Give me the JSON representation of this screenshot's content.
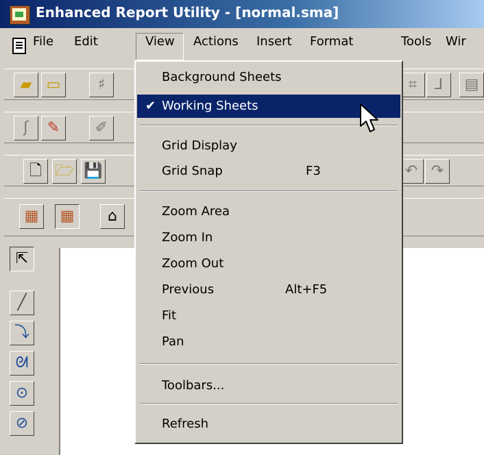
{
  "window": {
    "title": "Enhanced Report Utility - [normal.sma]",
    "icon": "app-icon"
  },
  "menubar": {
    "items": [
      "File",
      "Edit",
      "View",
      "Actions",
      "Insert",
      "Format",
      "Tools",
      "Wir"
    ],
    "active": "View"
  },
  "view_menu": {
    "items": [
      {
        "label": "Background Sheets",
        "shortcut": ""
      },
      {
        "label": "Working Sheets",
        "shortcut": "",
        "checked": true,
        "highlighted": true
      },
      {
        "label": "Grid Display",
        "shortcut": ""
      },
      {
        "label": "Grid Snap",
        "shortcut": "F3"
      },
      {
        "label": "Zoom Area",
        "shortcut": ""
      },
      {
        "label": "Zoom In",
        "shortcut": ""
      },
      {
        "label": "Zoom Out",
        "shortcut": ""
      },
      {
        "label": "Previous",
        "shortcut": "Alt+F5"
      },
      {
        "label": "Fit",
        "shortcut": ""
      },
      {
        "label": "Pan",
        "shortcut": ""
      },
      {
        "label": "Toolbars...",
        "shortcut": ""
      },
      {
        "label": "Refresh",
        "shortcut": ""
      }
    ]
  },
  "colors": {
    "highlight": "#0a246a",
    "face": "#d4d0c8",
    "title_start": "#0a246a"
  }
}
